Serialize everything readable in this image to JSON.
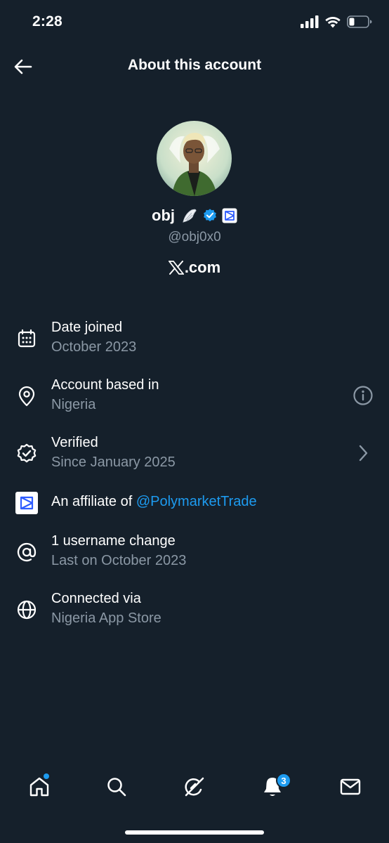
{
  "status_bar": {
    "time": "2:28"
  },
  "header": {
    "title": "About this account"
  },
  "profile": {
    "display_name": "obj",
    "handle": "@obj0x0",
    "domain_suffix": ".com",
    "domain_logo": "x-logo-icon"
  },
  "info": {
    "date_joined": {
      "title": "Date joined",
      "value": "October 2023",
      "icon": "calendar-icon"
    },
    "based_in": {
      "title": "Account based in",
      "value": "Nigeria",
      "icon": "location-pin-icon"
    },
    "verified": {
      "title": "Verified",
      "value": "Since January 2025",
      "icon": "verified-badge-icon"
    },
    "affiliate": {
      "prefix": "An affiliate of ",
      "handle": "@PolymarketTrade",
      "icon": "polymarket-logo-icon"
    },
    "username_change": {
      "title": "1 username change",
      "value": "Last on October 2023",
      "icon": "at-sign-icon"
    },
    "connected_via": {
      "title": "Connected via",
      "value": "Nigeria App Store",
      "icon": "globe-icon"
    }
  },
  "tab_bar": {
    "tabs": [
      "home-icon",
      "search-icon",
      "grok-icon",
      "bell-icon",
      "mail-icon"
    ],
    "notification_count": "3"
  },
  "colors": {
    "background": "#15202b",
    "accent": "#1d9bf0",
    "secondary_text": "#8b98a5"
  }
}
